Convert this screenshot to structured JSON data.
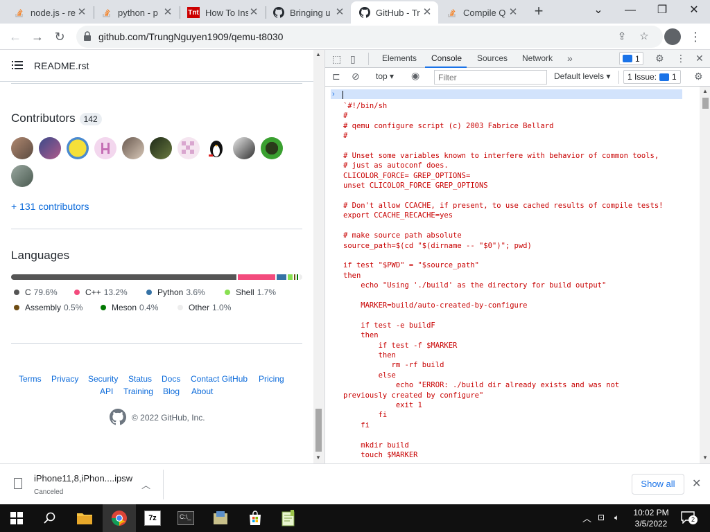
{
  "browser": {
    "tabs": [
      {
        "title": "node.js - re",
        "icon": "stackoverflow-icon"
      },
      {
        "title": "python - p",
        "icon": "stackoverflow-icon"
      },
      {
        "title": "How To Ins",
        "icon": "tnt-icon"
      },
      {
        "title": "Bringing u",
        "icon": "github-icon"
      },
      {
        "title": "GitHub - Tr",
        "icon": "github-icon"
      },
      {
        "title": "Compile Q",
        "icon": "stackoverflow-icon"
      }
    ],
    "active_tab_index": 4,
    "url": "github.com/TrungNguyen1909/qemu-t8030"
  },
  "github": {
    "readme_title": "README.rst",
    "contributors_title": "Contributors",
    "contributors_count": "142",
    "more_contributors": "+ 131 contributors",
    "languages_title": "Languages",
    "languages": [
      {
        "name": "C",
        "pct": "79.6%",
        "color": "#555555"
      },
      {
        "name": "C++",
        "pct": "13.2%",
        "color": "#f34b7d"
      },
      {
        "name": "Python",
        "pct": "3.6%",
        "color": "#3572A5"
      },
      {
        "name": "Shell",
        "pct": "1.7%",
        "color": "#89e051"
      },
      {
        "name": "Assembly",
        "pct": "0.5%",
        "color": "#6E4C13"
      },
      {
        "name": "Meson",
        "pct": "0.4%",
        "color": "#007800"
      },
      {
        "name": "Other",
        "pct": "1.0%",
        "color": "#ededed"
      }
    ],
    "footer_row1": [
      "Terms",
      "Privacy",
      "Security",
      "Status",
      "Docs",
      "Contact GitHub",
      "Pricing"
    ],
    "footer_row2": [
      "API",
      "Training",
      "Blog",
      "About"
    ],
    "copyright": "© 2022 GitHub, Inc."
  },
  "devtools": {
    "tabs": [
      "Elements",
      "Console",
      "Sources",
      "Network"
    ],
    "active_tab": "Console",
    "message_badge": "1",
    "context": "top",
    "filter_placeholder": "Filter",
    "levels": "Default levels",
    "issues_label": "1 Issue:",
    "issues_count": "1",
    "console_lines": [
      "`#!/bin/sh",
      "#",
      "# qemu configure script (c) 2003 Fabrice Bellard",
      "#",
      "",
      "# Unset some variables known to interfere with behavior of common tools,",
      "# just as autoconf does.",
      "CLICOLOR_FORCE= GREP_OPTIONS=",
      "unset CLICOLOR_FORCE GREP_OPTIONS",
      "",
      "# Don't allow CCACHE, if present, to use cached results of compile tests!",
      "export CCACHE_RECACHE=yes",
      "",
      "# make source path absolute",
      "source_path=$(cd \"$(dirname -- \"$0\")\"; pwd)",
      "",
      "if test \"$PWD\" = \"$source_path\"",
      "then",
      "    echo \"Using './build' as the directory for build output\"",
      "",
      "    MARKER=build/auto-created-by-configure",
      "",
      "    if test -e buildF",
      "    then",
      "        if test -f $MARKER",
      "        then",
      "           rm -rf build",
      "        else",
      "            echo \"ERROR: ./build dir already exists and was not",
      "previously created by configure\"",
      "            exit 1",
      "        fi",
      "    fi",
      "",
      "    mkdir build",
      "    touch $MARKER"
    ]
  },
  "download": {
    "filename": "iPhone11,8,iPhon....ipsw",
    "status": "Canceled",
    "show_all": "Show all"
  },
  "taskbar": {
    "time": "10:02 PM",
    "date": "3/5/2022",
    "notification_count": "2"
  }
}
